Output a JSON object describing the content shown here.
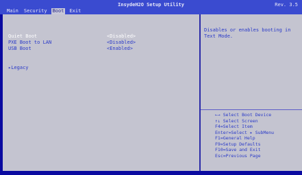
{
  "header": {
    "title": "InsydeH2O Setup Utility",
    "revision": "Rev. 3.5"
  },
  "tabs": [
    {
      "label": "Main"
    },
    {
      "label": "Security"
    },
    {
      "label": "Boot"
    },
    {
      "label": "Exit"
    }
  ],
  "active_tab": "Boot",
  "settings": {
    "quiet_boot": {
      "label": "Quiet Boot",
      "value": "<Disabled>"
    },
    "pxe_boot": {
      "label": "PXE Boot to LAN",
      "value": "<Disabled>"
    },
    "usb_boot": {
      "label": "USB Boot",
      "value": "<Enabled>"
    },
    "legacy": {
      "label": "▸Legacy"
    }
  },
  "help_text": "Disables or enables booting in Text Mode.",
  "key_help": [
    "←→     Select Boot Device",
    "↑↓     Select Screen",
    "F4=Select Item",
    "Enter=Select ▸ SubMenu",
    "F1=General Help",
    "F9=Setup Defaults",
    "F10=Save and Exit",
    "Esc=Previous Page"
  ],
  "colors": {
    "bios_blue": "#0000a8",
    "panel_gray": "#c4c4d0",
    "text_blue": "#2a3ac8",
    "highlight": "#ffffff"
  }
}
